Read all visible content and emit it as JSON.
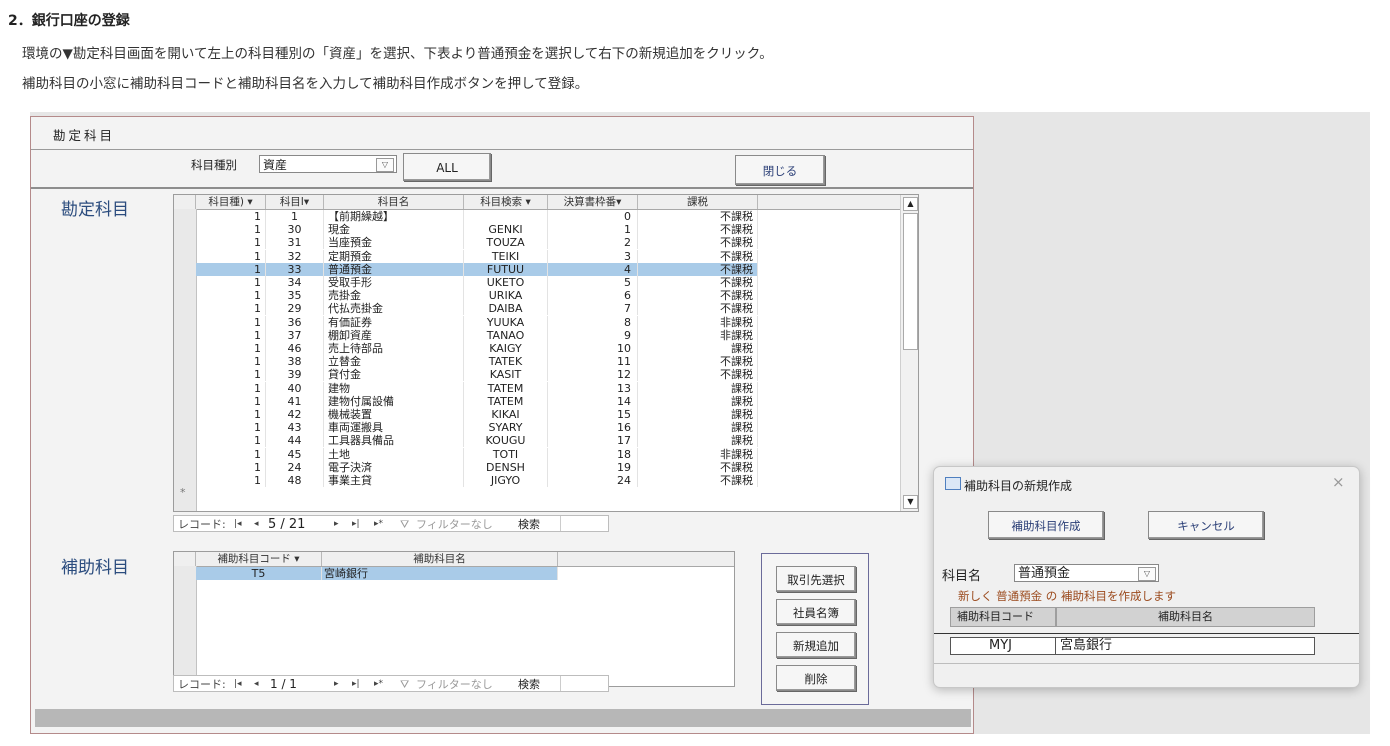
{
  "doc": {
    "heading": "2．銀行口座の登録",
    "line1": "環境の▼勘定科目画面を開いて左上の科目種別の「資産」を選択、下表より普通預金を選択して右下の新規追加をクリック。",
    "line2": "補助科目の小窓に補助科目コードと補助科目名を入力して補助科目作成ボタンを押して登録。"
  },
  "form": {
    "title": "勘定科目",
    "category_label": "科目種別",
    "category_value": "資産",
    "all_button": "ALL",
    "close_button": "閉じる",
    "main_section": "勘定科目",
    "sub_section": "補助科目"
  },
  "main_table": {
    "columns": [
      "科目種】▾",
      "科目I▾",
      "科目名",
      "▾",
      "科目検索 ▾",
      "決算書枠番▾",
      "課税",
      "▾"
    ],
    "header": {
      "col1": "科目種) ▾",
      "col2": "科目I▾",
      "col3": "科目名",
      "col4": "科目検索 ▾",
      "col5": "決算書枠番▾",
      "col6": "課税"
    },
    "rows": [
      [
        "1",
        "1",
        "【前期繰越】",
        "",
        "0",
        "不課税"
      ],
      [
        "1",
        "30",
        "現金",
        "GENKI",
        "1",
        "不課税"
      ],
      [
        "1",
        "31",
        "当座預金",
        "TOUZA",
        "2",
        "不課税"
      ],
      [
        "1",
        "32",
        "定期預金",
        "TEIKI",
        "3",
        "不課税"
      ],
      [
        "1",
        "33",
        "普通預金",
        "FUTUU",
        "4",
        "不課税"
      ],
      [
        "1",
        "34",
        "受取手形",
        "UKETO",
        "5",
        "不課税"
      ],
      [
        "1",
        "35",
        "売掛金",
        "URIKA",
        "6",
        "不課税"
      ],
      [
        "1",
        "29",
        "代払売掛金",
        "DAIBA",
        "7",
        "不課税"
      ],
      [
        "1",
        "36",
        "有価証券",
        "YUUKA",
        "8",
        "非課税"
      ],
      [
        "1",
        "37",
        "棚卸資産",
        "TANAO",
        "9",
        "非課税"
      ],
      [
        "1",
        "46",
        "売上待部品",
        "KAIGY",
        "10",
        "課税"
      ],
      [
        "1",
        "38",
        "立替金",
        "TATEK",
        "11",
        "不課税"
      ],
      [
        "1",
        "39",
        "貸付金",
        "KASIT",
        "12",
        "不課税"
      ],
      [
        "1",
        "40",
        "建物",
        "TATEM",
        "13",
        "課税"
      ],
      [
        "1",
        "41",
        "建物付属設備",
        "TATEM",
        "14",
        "課税"
      ],
      [
        "1",
        "42",
        "機械装置",
        "KIKAI",
        "15",
        "課税"
      ],
      [
        "1",
        "43",
        "車両運搬具",
        "SYARY",
        "16",
        "課税"
      ],
      [
        "1",
        "44",
        "工具器具備品",
        "KOUGU",
        "17",
        "課税"
      ],
      [
        "1",
        "45",
        "土地",
        "TOTI",
        "18",
        "非課税"
      ],
      [
        "1",
        "24",
        "電子決済",
        "DENSH",
        "19",
        "不課税"
      ],
      [
        "1",
        "48",
        "事業主貸",
        "JIGYO",
        "24",
        "不課税"
      ]
    ],
    "selected_index": 4,
    "new_row_marker": "*",
    "nav": {
      "label": "レコード:",
      "first": "|◂",
      "prev": "◂",
      "position": "5 / 21",
      "next": "▸",
      "last": "▸|",
      "new": "▸*",
      "filter": "フィルターなし",
      "search": "検索"
    }
  },
  "sub_table": {
    "header": {
      "col1": "補助科目コード ▾",
      "col2": "補助科目名"
    },
    "rows": [
      [
        "T5",
        "宮崎銀行"
      ]
    ],
    "nav": {
      "label": "レコード:",
      "first": "|◂",
      "prev": "◂",
      "position": "1 / 1",
      "next": "▸",
      "last": "▸|",
      "new": "▸*",
      "filter": "フィルターなし",
      "search": "検索"
    }
  },
  "side_buttons": {
    "client_select": "取引先選択",
    "staff_list": "社員名簿",
    "new_add": "新規追加",
    "delete": "削除"
  },
  "dialog": {
    "title": "補助科目の新規作成",
    "close": "×",
    "create_button": "補助科目作成",
    "cancel_button": "キャンセル",
    "account_label": "科目名",
    "account_value": "普通預金",
    "message": "新しく 普通預金 の 補助科目を作成します",
    "col_code": "補助科目コード",
    "col_name": "補助科目名",
    "code_value": "MYJ",
    "name_value": "宮島銀行"
  },
  "colors": {
    "selected_row": "#a9cbe8",
    "section_text": "#2b4c7e",
    "message_text": "#9b4a1d"
  }
}
